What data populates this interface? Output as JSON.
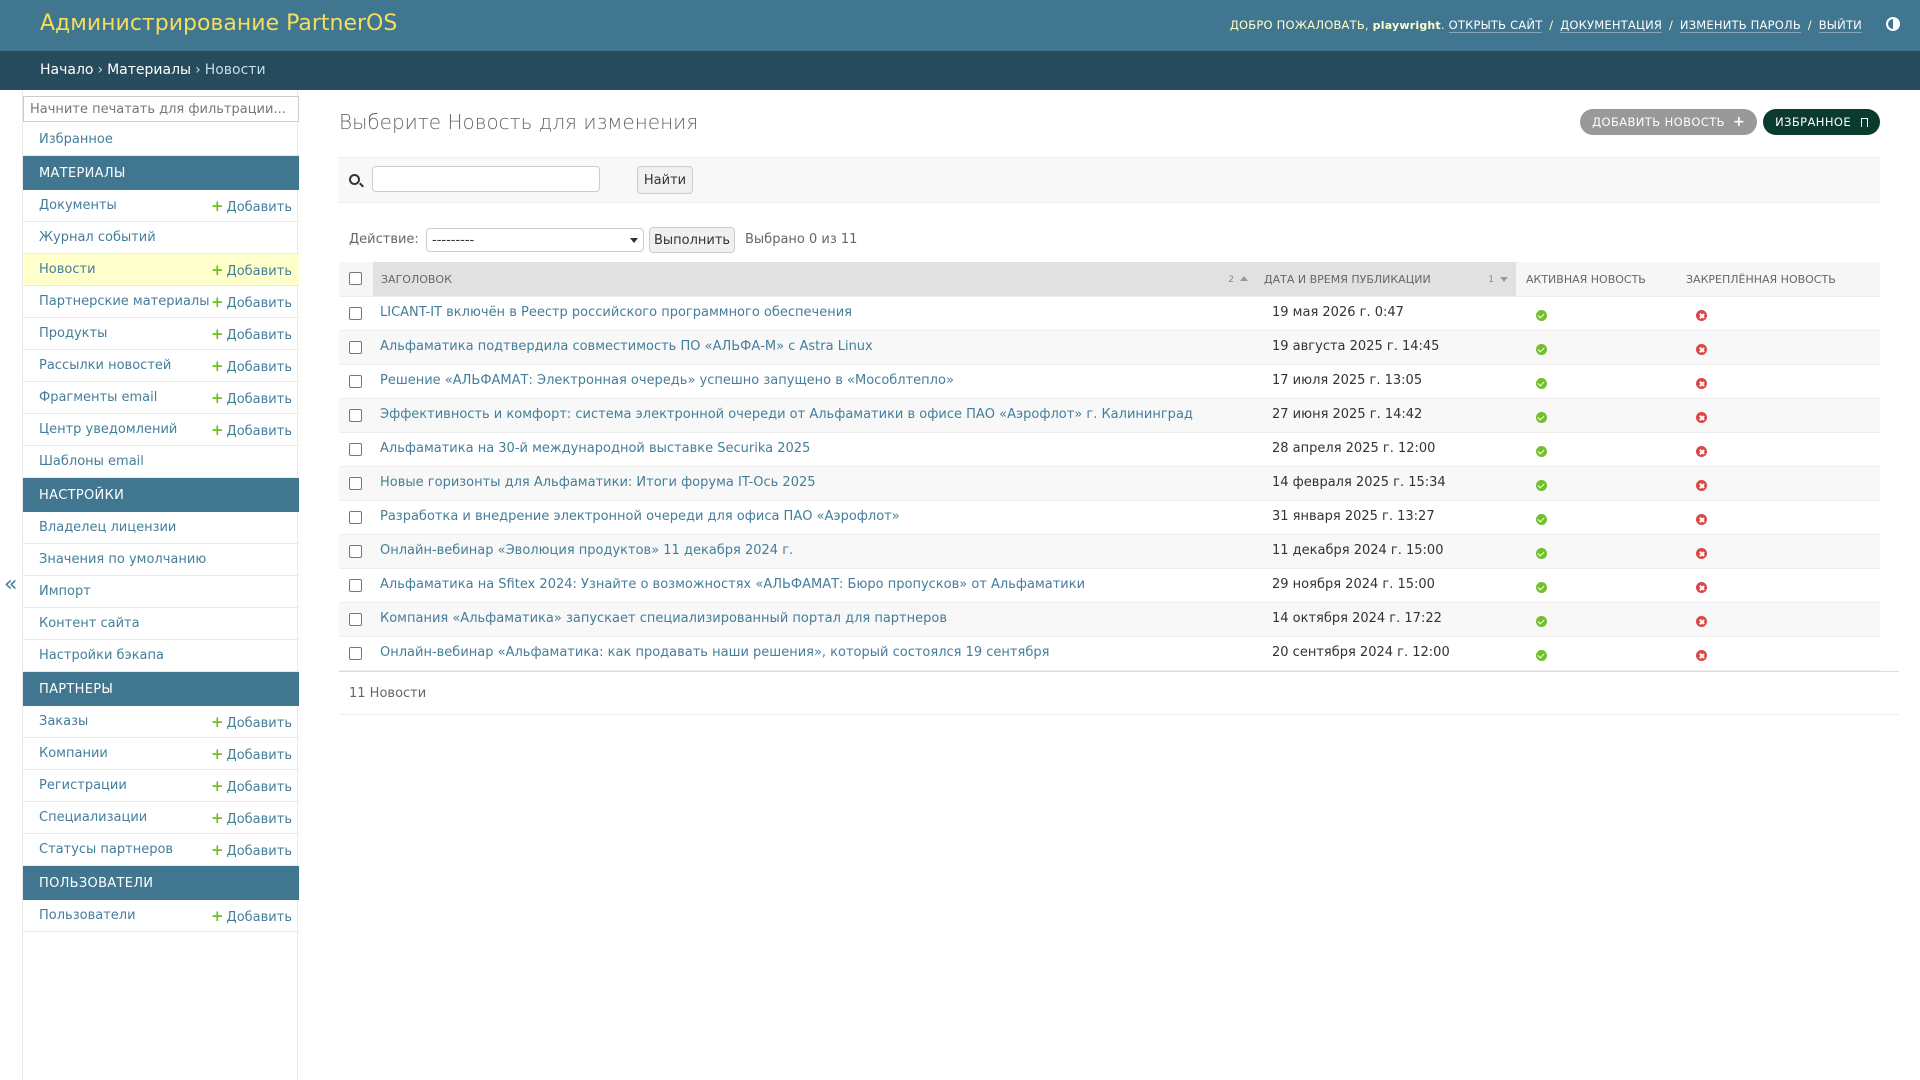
{
  "header": {
    "title": "Администрирование PartnerOS",
    "welcome": "Добро пожаловать,",
    "username": "playwright",
    "links": [
      "Открыть сайт",
      "Документация",
      "Изменить пароль",
      "Выйти"
    ]
  },
  "breadcrumbs": [
    "Начало",
    "Материалы",
    "Новости"
  ],
  "sidebar": {
    "filter_placeholder": "Начните печатать для фильтрации...",
    "add_label": "Добавить",
    "favorites": "Избранное",
    "sections": [
      {
        "caption": "Материалы",
        "items": [
          {
            "label": "Документы",
            "add": true
          },
          {
            "label": "Журнал событий",
            "add": false
          },
          {
            "label": "Новости",
            "add": true,
            "current": true
          },
          {
            "label": "Партнерские материалы",
            "add": true
          },
          {
            "label": "Продукты",
            "add": true
          },
          {
            "label": "Рассылки новостей",
            "add": true
          },
          {
            "label": "Фрагменты email",
            "add": true
          },
          {
            "label": "Центр уведомлений",
            "add": true
          },
          {
            "label": "Шаблоны email",
            "add": false
          }
        ]
      },
      {
        "caption": "Настройки",
        "items": [
          {
            "label": "Владелец лицензии",
            "add": false
          },
          {
            "label": "Значения по умолчанию",
            "add": false
          },
          {
            "label": "Импорт",
            "add": false
          },
          {
            "label": "Контент сайта",
            "add": false
          },
          {
            "label": "Настройки бэкапа",
            "add": false
          }
        ]
      },
      {
        "caption": "Партнеры",
        "items": [
          {
            "label": "Заказы",
            "add": true
          },
          {
            "label": "Компании",
            "add": true
          },
          {
            "label": "Регистрации",
            "add": true
          },
          {
            "label": "Специализации",
            "add": true
          },
          {
            "label": "Статусы партнеров",
            "add": true
          }
        ]
      },
      {
        "caption": "Пользователи",
        "items": [
          {
            "label": "Пользователи",
            "add": true
          }
        ]
      }
    ],
    "collapse_glyph": "«"
  },
  "content": {
    "title": "Выберите Новость для изменения",
    "add_button": "Добавить новость",
    "favorites_button": "Избранное",
    "search_button": "Найти",
    "action_label": "Действие:",
    "action_selected": "---------",
    "run_button": "Выполнить",
    "selection_counter": "Выбрано 0 из 11",
    "columns": [
      "Заголовок",
      "Дата и время публикации",
      "Активная новость",
      "Закреплённая новость"
    ],
    "sort_priority": [
      "2",
      "1"
    ],
    "rows": [
      {
        "title": "LICANT-IT включён в Реестр российского программного обеспечения",
        "date": "19 мая 2026 г. 0:47",
        "active": true,
        "pinned": false
      },
      {
        "title": "Альфаматика подтвердила совместимость ПО «АЛЬФА-М» с Astra Linux",
        "date": "19 августа 2025 г. 14:45",
        "active": true,
        "pinned": false
      },
      {
        "title": "Решение «АЛЬФАМАТ: Электронная очередь» успешно запущено в «Мособлтепло»",
        "date": "17 июля 2025 г. 13:05",
        "active": true,
        "pinned": false
      },
      {
        "title": "Эффективность и комфорт: система электронной очереди от Альфаматики в офисе ПАО «Аэрофлот» г. Калининград",
        "date": "27 июня 2025 г. 14:42",
        "active": true,
        "pinned": false
      },
      {
        "title": "Альфаматика на 30-й международной выставке Securika 2025",
        "date": "28 апреля 2025 г. 12:00",
        "active": true,
        "pinned": false
      },
      {
        "title": "Новые горизонты для Альфаматики: Итоги форума IT-Ось 2025",
        "date": "14 февраля 2025 г. 15:34",
        "active": true,
        "pinned": false
      },
      {
        "title": "Разработка и внедрение электронной очереди для офиса ПАО «Аэрофлот»",
        "date": "31 января 2025 г. 13:27",
        "active": true,
        "pinned": false
      },
      {
        "title": "Онлайн-вебинар «Эволюция продуктов» 11 декабря 2024 г.",
        "date": "11 декабря 2024 г. 15:00",
        "active": true,
        "pinned": false
      },
      {
        "title": "Альфаматика на Sfitex 2024: Узнайте о возможностях «АЛЬФАМАТ: Бюро пропусков» от Альфаматики",
        "date": "29 ноября 2024 г. 15:00",
        "active": true,
        "pinned": false
      },
      {
        "title": "Компания «Альфаматика» запускает специализированный портал для партнеров",
        "date": "14 октября 2024 г. 17:22",
        "active": true,
        "pinned": false
      },
      {
        "title": "Онлайн-вебинар «Альфаматика: как продавать наши решения», который состоялся 19 сентября",
        "date": "20 сентября 2024 г. 12:00",
        "active": true,
        "pinned": false
      }
    ],
    "paginator": "11 Новости"
  },
  "colors": {
    "header_bg": "#417690",
    "breadcrumbs_bg": "#264b5d",
    "brand_text": "#f5dd5d",
    "link": "#447e9b",
    "add_plus": "#70bf2b",
    "current_row": "#ffffcc",
    "ok": "#70bf2b",
    "no": "#dd4646"
  }
}
